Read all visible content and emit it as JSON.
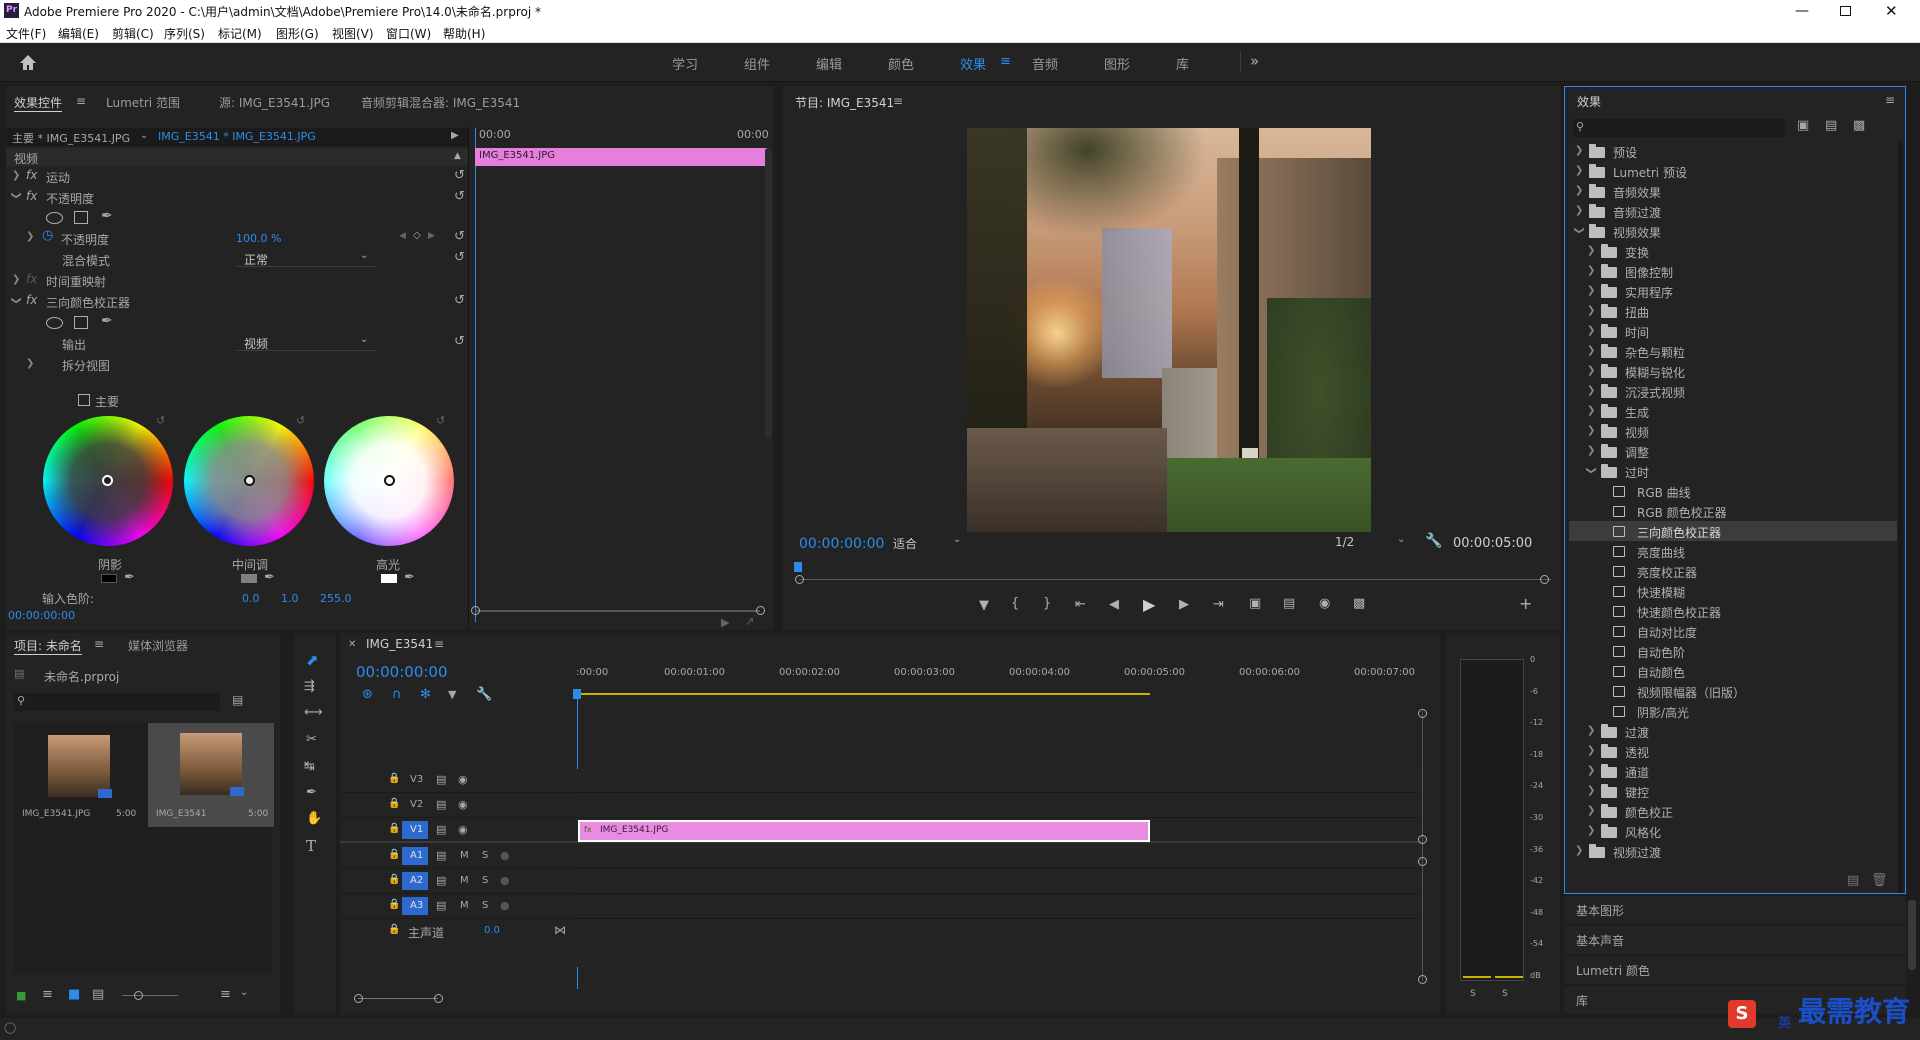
{
  "app": {
    "title": "Adobe Premiere Pro 2020 - C:\\用户\\admin\\文档\\Adobe\\Premiere Pro\\14.0\\未命名.prproj *",
    "logo": "Pr"
  },
  "menu": [
    "文件(F)",
    "编辑(E)",
    "剪辑(C)",
    "序列(S)",
    "标记(M)",
    "图形(G)",
    "视图(V)",
    "窗口(W)",
    "帮助(H)"
  ],
  "workspaces": [
    "学习",
    "组件",
    "编辑",
    "颜色",
    "效果",
    "音频",
    "图形",
    "库"
  ],
  "active_workspace": "效果",
  "effect_controls": {
    "tabs": [
      "效果控件",
      "Lumetri 范围",
      "源: IMG_E3541.JPG",
      "音频剪辑混合器: IMG_E3541"
    ],
    "master": "主要 * IMG_E3541.JPG",
    "clip": "IMG_E3541 * IMG_E3541.JPG",
    "time_start": "00:00",
    "time_end": "00:00",
    "clip_bar": "IMG_E3541.JPG",
    "section": "视频",
    "motion": "运动",
    "opacity": "不透明度",
    "opacity_prop": "不透明度",
    "opacity_value": "100.0 %",
    "blend_label": "混合模式",
    "blend_value": "正常",
    "time_remap": "时间重映射",
    "three_way": "三向颜色校正器",
    "output_label": "输出",
    "output_value": "视频",
    "split_view": "拆分视图",
    "master_cb": "主要",
    "wheels": [
      "阴影",
      "中间调",
      "高光"
    ],
    "input_levels_label": "输入色阶:",
    "input_levels": [
      "0.0",
      "1.0",
      "255.0"
    ],
    "timecode": "00:00:00:00"
  },
  "program": {
    "title": "节目: IMG_E3541",
    "timecode": "00:00:00:00",
    "fit": "适合",
    "resolution": "1/2",
    "duration": "00:00:05:00"
  },
  "effects_panel": {
    "title": "效果",
    "tree": [
      {
        "label": "预设",
        "level": 0,
        "type": "folder"
      },
      {
        "label": "Lumetri 预设",
        "level": 0,
        "type": "folder"
      },
      {
        "label": "音频效果",
        "level": 0,
        "type": "folder"
      },
      {
        "label": "音频过渡",
        "level": 0,
        "type": "folder"
      },
      {
        "label": "视频效果",
        "level": 0,
        "type": "folder",
        "open": true
      },
      {
        "label": "变换",
        "level": 1,
        "type": "folder"
      },
      {
        "label": "图像控制",
        "level": 1,
        "type": "folder"
      },
      {
        "label": "实用程序",
        "level": 1,
        "type": "folder"
      },
      {
        "label": "扭曲",
        "level": 1,
        "type": "folder"
      },
      {
        "label": "时间",
        "level": 1,
        "type": "folder"
      },
      {
        "label": "杂色与颗粒",
        "level": 1,
        "type": "folder"
      },
      {
        "label": "模糊与锐化",
        "level": 1,
        "type": "folder"
      },
      {
        "label": "沉浸式视频",
        "level": 1,
        "type": "folder"
      },
      {
        "label": "生成",
        "level": 1,
        "type": "folder"
      },
      {
        "label": "视频",
        "level": 1,
        "type": "folder"
      },
      {
        "label": "调整",
        "level": 1,
        "type": "folder"
      },
      {
        "label": "过时",
        "level": 1,
        "type": "folder",
        "open": true
      },
      {
        "label": "RGB 曲线",
        "level": 2,
        "type": "effect"
      },
      {
        "label": "RGB 颜色校正器",
        "level": 2,
        "type": "effect"
      },
      {
        "label": "三向颜色校正器",
        "level": 2,
        "type": "effect",
        "selected": true
      },
      {
        "label": "亮度曲线",
        "level": 2,
        "type": "effect"
      },
      {
        "label": "亮度校正器",
        "level": 2,
        "type": "effect"
      },
      {
        "label": "快速模糊",
        "level": 2,
        "type": "effect"
      },
      {
        "label": "快速颜色校正器",
        "level": 2,
        "type": "effect"
      },
      {
        "label": "自动对比度",
        "level": 2,
        "type": "effect"
      },
      {
        "label": "自动色阶",
        "level": 2,
        "type": "effect"
      },
      {
        "label": "自动颜色",
        "level": 2,
        "type": "effect"
      },
      {
        "label": "视频限幅器（旧版）",
        "level": 2,
        "type": "effect"
      },
      {
        "label": "阴影/高光",
        "level": 2,
        "type": "effect"
      },
      {
        "label": "过渡",
        "level": 1,
        "type": "folder"
      },
      {
        "label": "透视",
        "level": 1,
        "type": "folder"
      },
      {
        "label": "通道",
        "level": 1,
        "type": "folder"
      },
      {
        "label": "键控",
        "level": 1,
        "type": "folder"
      },
      {
        "label": "颜色校正",
        "level": 1,
        "type": "folder"
      },
      {
        "label": "风格化",
        "level": 1,
        "type": "folder"
      },
      {
        "label": "视频过渡",
        "level": 0,
        "type": "folder"
      }
    ],
    "collapsed_panels": [
      "基本图形",
      "基本声音",
      "Lumetri 颜色",
      "库"
    ]
  },
  "project": {
    "tabs": [
      "项目: 未命名",
      "媒体浏览器"
    ],
    "file": "未命名.prproj",
    "items": [
      {
        "name": "IMG_E3541.JPG",
        "duration": "5:00"
      },
      {
        "name": "IMG_E3541",
        "duration": "5:00"
      }
    ]
  },
  "timeline": {
    "tab": "IMG_E3541",
    "timecode": "00:00:00:00",
    "ruler": [
      ":00:00",
      "00:00:01:00",
      "00:00:02:00",
      "00:00:03:00",
      "00:00:04:00",
      "00:00:05:00",
      "00:00:06:00",
      "00:00:07:00"
    ],
    "video_tracks": [
      "V3",
      "V2",
      "V1"
    ],
    "audio_tracks": [
      "A1",
      "A2",
      "A3"
    ],
    "mute": "M",
    "solo": "S",
    "master_label": "主声道",
    "master_value": "0.0",
    "clip": "IMG_E3541.JPG"
  },
  "meter": {
    "scale": [
      "0",
      "-6",
      "-12",
      "-18",
      "-24",
      "-30",
      "-36",
      "-42",
      "-48",
      "-54",
      "dB"
    ],
    "solo": [
      "S",
      "S"
    ]
  },
  "watermark": "最需教育",
  "ime": "英"
}
